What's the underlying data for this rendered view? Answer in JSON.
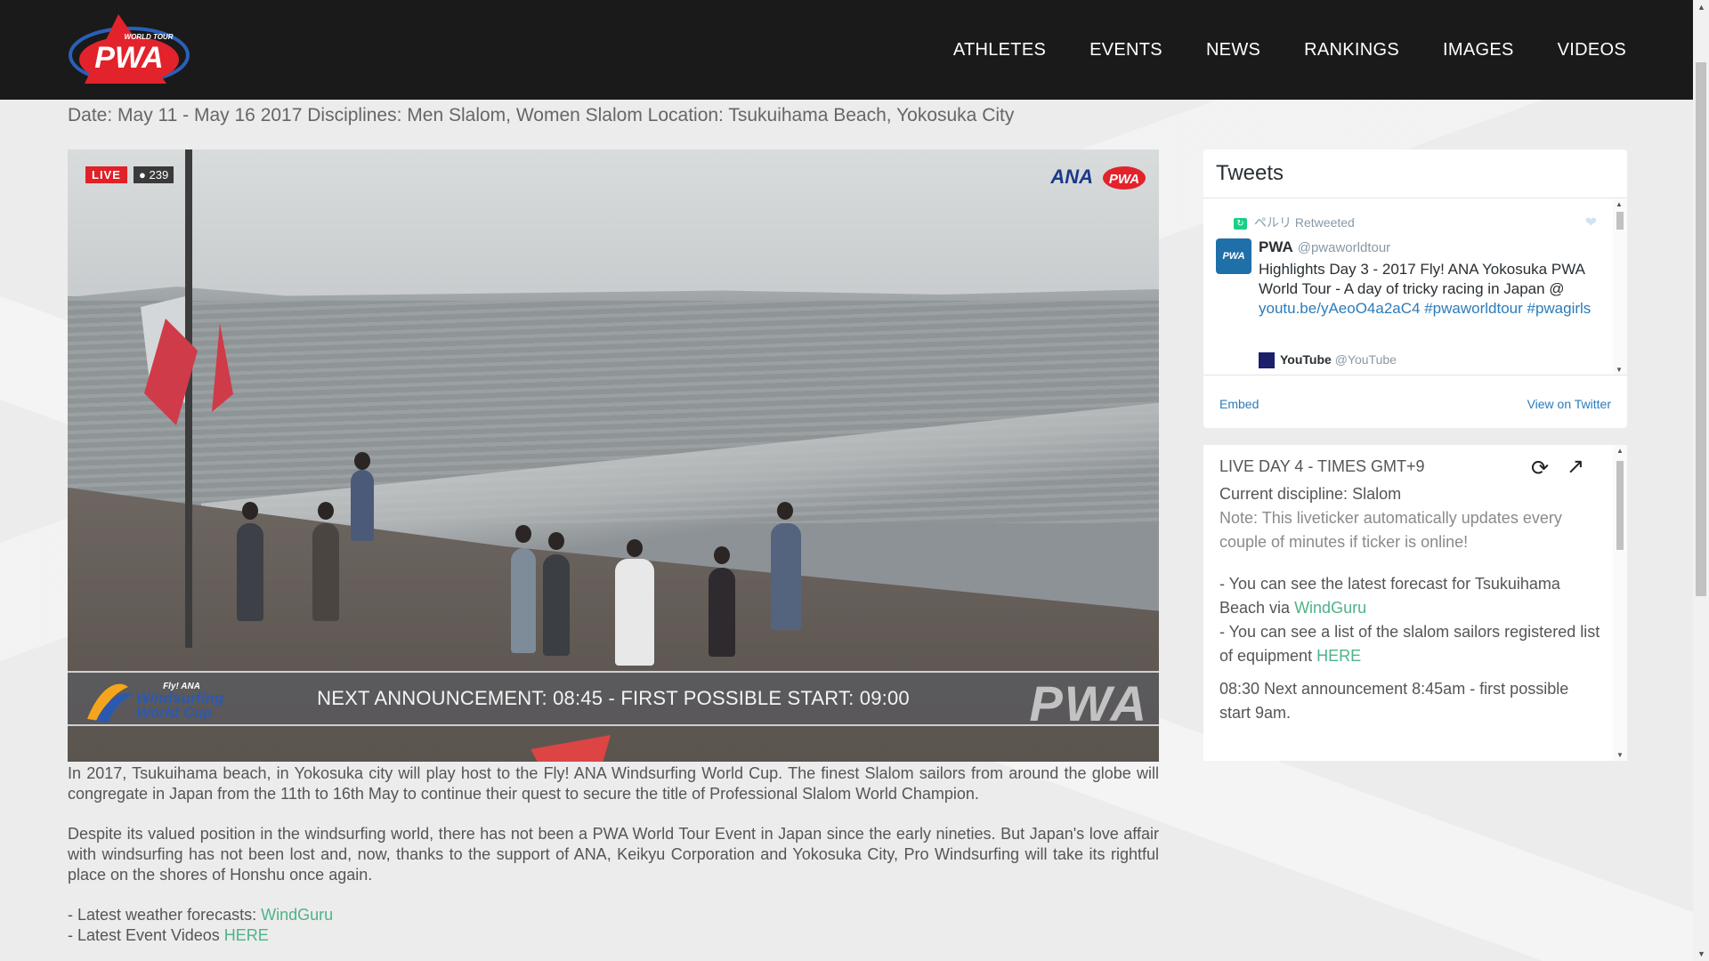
{
  "header": {
    "logo_text": "PWA",
    "logo_sub": "WORLD TOUR",
    "nav": [
      "ATHLETES",
      "EVENTS",
      "NEWS",
      "RANKINGS",
      "IMAGES",
      "VIDEOS"
    ]
  },
  "event": {
    "info": "Date: May 11 - May 16 2017 Disciplines: Men Slalom, Women Slalom Location: Tsukuihama Beach, Yokosuka City"
  },
  "video": {
    "live_label": "LIVE",
    "viewers": "239",
    "sponsor": "ANA",
    "overlay_text": "NEXT ANNOUNCEMENT: 08:45 - FIRST POSSIBLE START: 09:00",
    "event_logo": "Fly! ANA Windsurfing World Cup",
    "watermark": "PWA"
  },
  "article": {
    "p1": "In 2017, Tsukuihama beach, in Yokosuka city will play host to the Fly! ANA Windsurfing World Cup. The finest Slalom sailors from around the globe will congregate in Japan from the 11th to 16th May to continue their quest to secure the title of Professional Slalom World Champion.",
    "p2": "Despite its valued position in the windsurfing world, there has not been a PWA World Tour Event in Japan since the early nineties. But Japan's love affair with windsurfing has not been lost and, now, thanks to the support of ANA, Keikyu Corporation and Yokosuka City, Pro Windsurfing will take its rightful place on the shores of Honshu once again.",
    "weather_label": "- Latest weather forecasts: ",
    "weather_link": "WindGuru",
    "videos_label": "- Latest Event Videos ",
    "videos_link": "HERE"
  },
  "tweets": {
    "title": "Tweets",
    "retweeted_by": "ペルリ Retweeted",
    "author_name": "PWA",
    "author_handle": "@pwaworldtour",
    "text": "Highlights Day 3 - 2017 Fly! ANA Yokosuka PWA World Tour - A day of tricky racing in Japan @",
    "link1": "youtu.be/yAeoO4a2aC4",
    "hashtag1": "#pwaworldtour",
    "hashtag2": "#pwagirls",
    "quoted_name": "YouTube",
    "quoted_handle": "@YouTube",
    "embed": "Embed",
    "view_on_twitter": "View on Twitter"
  },
  "ticker": {
    "title": "LIVE DAY 4 - TIMES GMT+9",
    "discipline": "Current discipline: Slalom",
    "note": "Note: This liveticker automatically updates every couple of minutes if ticker is online!",
    "forecast_text": "- You can see the latest forecast for Tsukuihama Beach via ",
    "forecast_link": "WindGuru",
    "sailors_text": "- You can see a list of the slalom sailors registered list of equipment ",
    "sailors_link": "HERE",
    "entry": "08:30 Next announcement 8:45am - first possible start 9am."
  },
  "colors": {
    "header_bg": "#1a1a1a",
    "link_green": "#4eb389",
    "twitter_blue": "#2b7bb9",
    "live_red": "#e02127"
  }
}
